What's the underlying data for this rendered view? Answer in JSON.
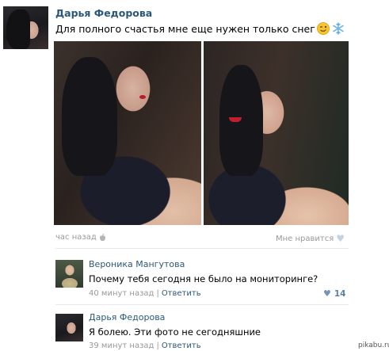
{
  "post": {
    "author": "Дарья Федорова",
    "text": "Для полного счастья мне еще нужен только снег",
    "emojis": [
      "wink-emoji",
      "snowflake-emoji"
    ],
    "time": "час назад",
    "like_label": "Мне нравится"
  },
  "comments": [
    {
      "author": "Вероника Мангутова",
      "text": "Почему тебя сегодня не было на мониторинге?",
      "time": "40 минут назад",
      "separator": "|",
      "reply_label": "Ответить",
      "likes": "14"
    },
    {
      "author": "Дарья Федорова",
      "text": "Я болею. Эти фото не сегодняшние",
      "time": "39 минут назад",
      "separator": "|",
      "reply_label": "Ответить"
    }
  ],
  "watermark": "pikabu.ru",
  "colors": {
    "link": "#2b587a",
    "meta": "#999999",
    "heart_light": "#c5d2e0",
    "heart_active": "#7595b8"
  }
}
